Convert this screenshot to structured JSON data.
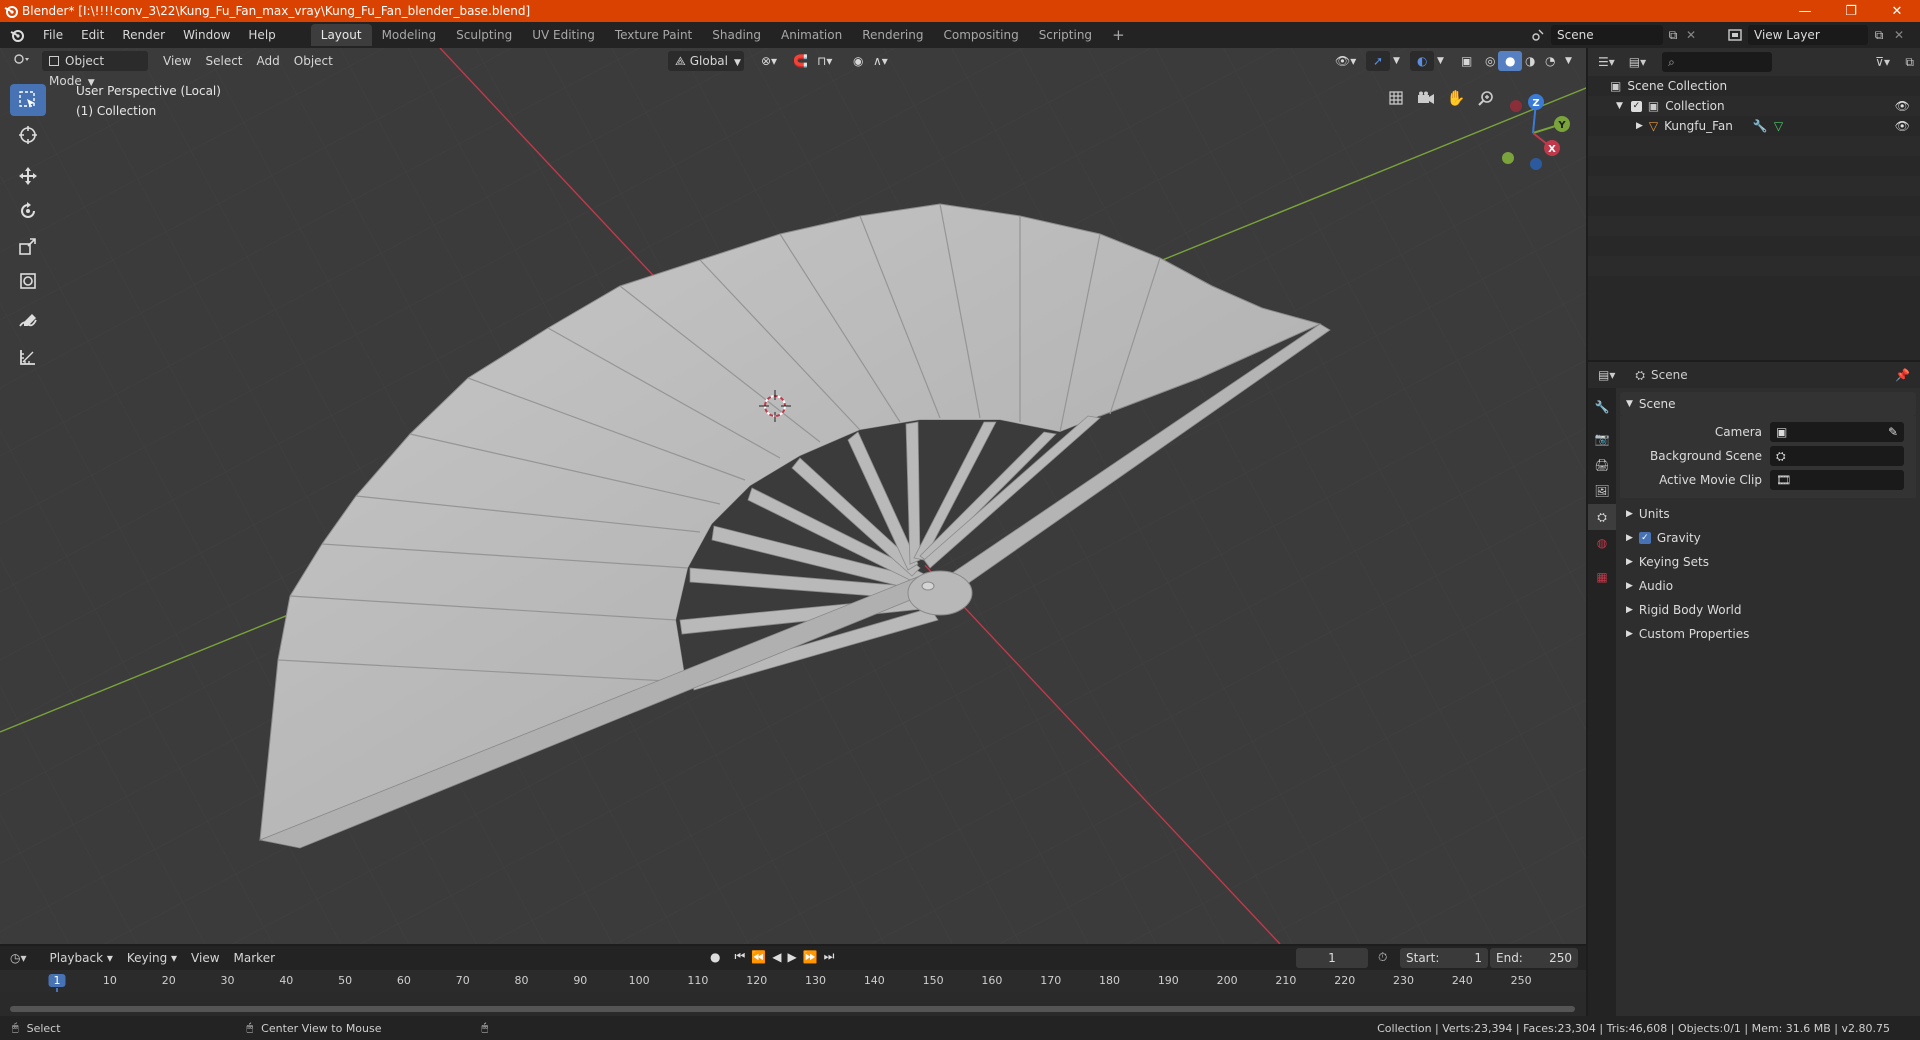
{
  "window": {
    "title": "Blender* [I:\\!!!!conv_3\\22\\Kung_Fu_Fan_max_vray\\Kung_Fu_Fan_blender_base.blend]",
    "minimize": "—",
    "maximize": "❐",
    "close": "✕"
  },
  "menus": [
    "File",
    "Edit",
    "Render",
    "Window",
    "Help"
  ],
  "workspaces": [
    "Layout",
    "Modeling",
    "Sculpting",
    "UV Editing",
    "Texture Paint",
    "Shading",
    "Animation",
    "Rendering",
    "Compositing",
    "Scripting"
  ],
  "workspace_add": "+",
  "scene_field": "Scene",
  "view_layer_field": "View Layer",
  "viewport": {
    "mode": "Object Mode",
    "menus": [
      "View",
      "Select",
      "Add",
      "Object"
    ],
    "orientation": "Global",
    "perspective_label": "User Perspective (Local)",
    "collection_label": "(1) Collection",
    "gizmo": {
      "x": "X",
      "y": "Y",
      "z": "Z"
    }
  },
  "outliner": {
    "search_placeholder": "",
    "scene_collection": "Scene Collection",
    "collection": "Collection",
    "object": "Kungfu_Fan"
  },
  "properties": {
    "header": "Scene",
    "section": "Scene",
    "camera_label": "Camera",
    "background_scene_label": "Background Scene",
    "active_movie_clip_label": "Active Movie Clip",
    "panels": [
      "Units",
      "Gravity",
      "Keying Sets",
      "Audio",
      "Rigid Body World",
      "Custom Properties"
    ]
  },
  "timeline": {
    "menus": [
      "Playback",
      "Keying",
      "View",
      "Marker"
    ],
    "current_frame": "1",
    "start_label": "Start:",
    "start_value": "1",
    "end_label": "End:",
    "end_value": "250",
    "ruler": [
      "1",
      "10",
      "20",
      "30",
      "40",
      "50",
      "60",
      "70",
      "80",
      "90",
      "100",
      "110",
      "120",
      "130",
      "140",
      "150",
      "160",
      "170",
      "180",
      "190",
      "200",
      "210",
      "220",
      "230",
      "240",
      "250"
    ]
  },
  "statusbar": {
    "select": "Select",
    "center_view": "Center View to Mouse",
    "stats": "Collection | Verts:23,394 | Faces:23,304 | Tris:46,608 | Objects:0/1 | Mem: 31.6 MB | v2.80.75"
  },
  "colors": {
    "titlebar": "#d94200",
    "active_tool": "#4772b3",
    "x_axis": "#c0394a",
    "y_axis": "#7aa33b",
    "z_axis": "#3a7bd5"
  }
}
